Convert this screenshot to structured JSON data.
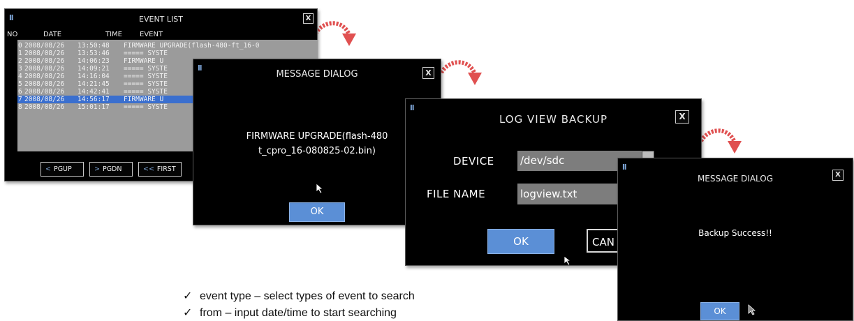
{
  "event_list": {
    "title": "EVENT LIST",
    "close_label": "X",
    "columns": [
      "NO",
      "DATE",
      "TIME",
      "EVENT"
    ],
    "rows": [
      {
        "no": "0",
        "date": "2008/08/26",
        "time": "13:50:48",
        "event": "FIRMWARE UPGRADE(flash-480-ft_16-0"
      },
      {
        "no": "1",
        "date": "2008/08/26",
        "time": "13:53:46",
        "event": "===== SYSTE"
      },
      {
        "no": "2",
        "date": "2008/08/26",
        "time": "14:06:23",
        "event": "FIRMWARE U"
      },
      {
        "no": "3",
        "date": "2008/08/26",
        "time": "14:09:21",
        "event": "===== SYSTE"
      },
      {
        "no": "4",
        "date": "2008/08/26",
        "time": "14:16:04",
        "event": "===== SYSTE"
      },
      {
        "no": "5",
        "date": "2008/08/26",
        "time": "14:21:45",
        "event": "===== SYSTE"
      },
      {
        "no": "6",
        "date": "2008/08/26",
        "time": "14:42:41",
        "event": "===== SYSTE"
      },
      {
        "no": "7",
        "date": "2008/08/26",
        "time": "14:56:17",
        "event": "FIRMWARE U"
      },
      {
        "no": "8",
        "date": "2008/08/26",
        "time": "15:01:17",
        "event": "===== SYSTE"
      }
    ],
    "selected_row": 7,
    "nav": {
      "pgup": "PGUP",
      "pgdn": "PGDN",
      "first": "FIRST"
    }
  },
  "message_dialog_1": {
    "title": "MESSAGE DIALOG",
    "close_label": "X",
    "message_line1": "FIRMWARE UPGRADE(flash-480",
    "message_line2": "t_cpro_16-080825-02.bin)",
    "ok_label": "OK"
  },
  "log_view_backup": {
    "title": "LOG VIEW BACKUP",
    "close_label": "X",
    "device_label": "DEVICE",
    "device_value": "/dev/sdc",
    "filename_label": "FILE NAME",
    "filename_value": "logview.txt",
    "ok_label": "OK",
    "cancel_label": "CAN"
  },
  "message_dialog_2": {
    "title": "MESSAGE DIALOG",
    "close_label": "X",
    "message": "Backup Success!!",
    "ok_label": "OK"
  },
  "notes": [
    "event type – select types of event to search",
    "from – input date/time to start searching"
  ],
  "colors": {
    "accent": "#5b8fd6",
    "selection": "#3a6fcf",
    "arrow": "#e05050",
    "list_bg": "#9b9b9b"
  }
}
